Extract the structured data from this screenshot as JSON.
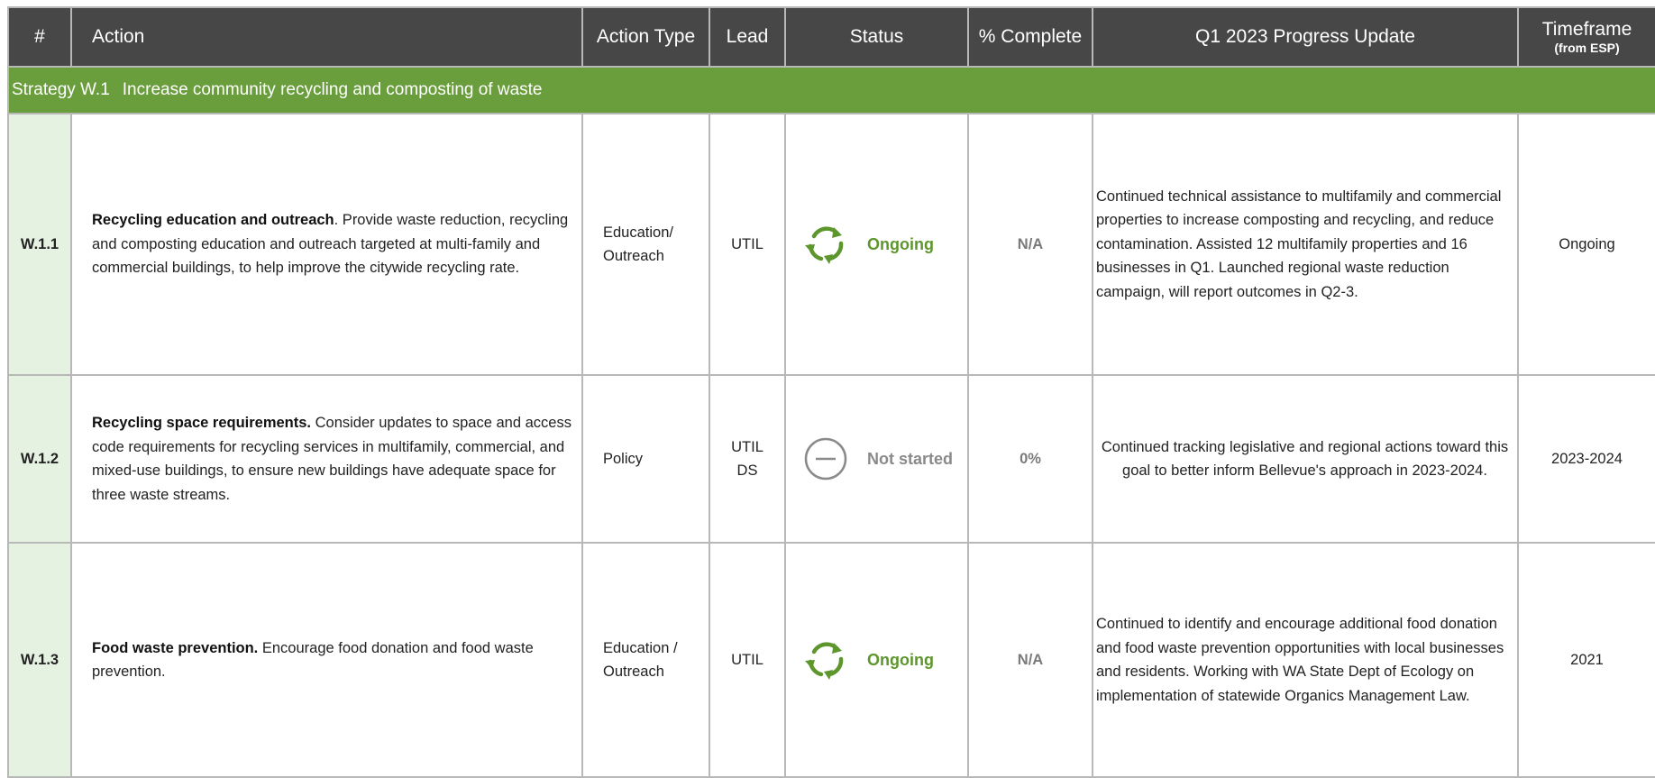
{
  "header": {
    "num": "#",
    "action": "Action",
    "action_type": "Action Type",
    "lead": "Lead",
    "status": "Status",
    "pct": "% Complete",
    "update": "Q1 2023 Progress Update",
    "timeframe": "Timeframe",
    "timeframe_sub": "(from ESP)"
  },
  "strategy": {
    "code": "Strategy W.1",
    "title": "Increase community recycling and composting of waste"
  },
  "colors": {
    "header_bg": "#474747",
    "strategy_bg": "#6a9e3d",
    "num_bg": "#e6f2e1",
    "ongoing": "#5d962c",
    "not_started": "#8a8a8a"
  },
  "rows": [
    {
      "num": "W.1.1",
      "action_title": "Recycling education and outreach",
      "action_body": ". Provide waste reduction, recycling and composting education and outreach targeted at multi-family and commercial buildings, to help improve the citywide recycling rate.",
      "action_type": "Education/ Outreach",
      "lead": "UTIL",
      "status_icon": "recycle-arrows-icon",
      "status": "Ongoing",
      "pct": "N/A",
      "update": "Continued technical assistance to multifamily and commercial properties to increase composting and recycling, and reduce contamination. Assisted 12 multifamily properties and 16 businesses in Q1. Launched regional waste reduction campaign, will report outcomes in Q2-3.",
      "timeframe": "Ongoing"
    },
    {
      "num": "W.1.2",
      "action_title": "Recycling space requirements.",
      "action_body": " Consider updates to space and access code requirements for recycling services in multifamily, commercial, and mixed-use buildings, to ensure new buildings have adequate space for three waste streams.",
      "action_type": "Policy",
      "lead": "UTIL",
      "lead2": "DS",
      "status_icon": "minus-circle-icon",
      "status": "Not started",
      "pct": "0%",
      "update": "Continued tracking legislative and regional actions toward this goal to better inform Bellevue's approach in 2023-2024.",
      "timeframe": "2023-2024"
    },
    {
      "num": "W.1.3",
      "action_title": "Food waste prevention.",
      "action_body": " Encourage food donation and food waste prevention.",
      "action_type": "Education / Outreach",
      "lead": "UTIL",
      "status_icon": "recycle-arrows-icon",
      "status": "Ongoing",
      "pct": "N/A",
      "update": "Continued to identify and encourage additional food donation and food waste prevention opportunities with local businesses and residents. Working with WA State Dept of Ecology on implementation of statewide Organics Management Law.",
      "timeframe": "2021"
    }
  ]
}
